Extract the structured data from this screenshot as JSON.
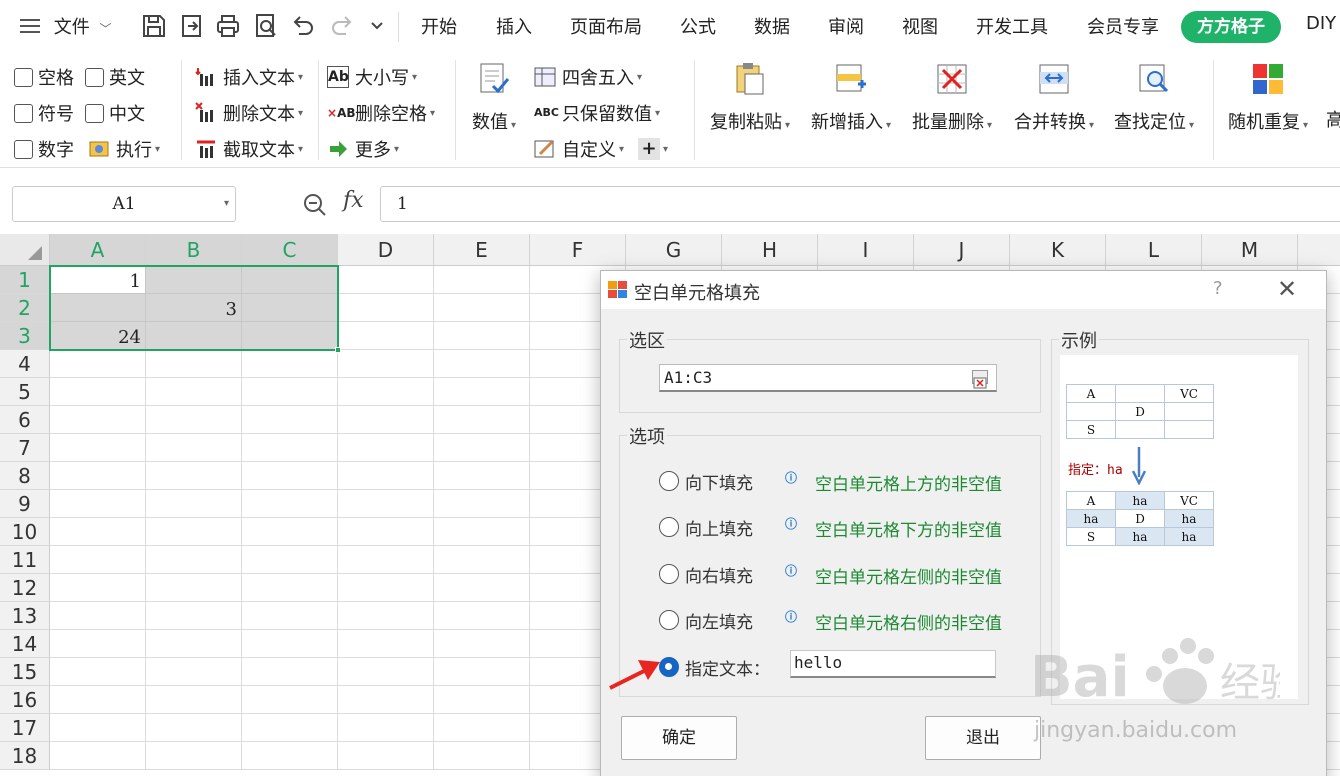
{
  "menu": {
    "file": "文件",
    "tabs": [
      "开始",
      "插入",
      "页面布局",
      "公式",
      "数据",
      "审阅",
      "视图",
      "开发工具",
      "会员专享"
    ],
    "active_tab": "方方格子",
    "diy": "DIY"
  },
  "ribbon": {
    "checkboxes": [
      "空格",
      "英文",
      "符号",
      "中文",
      "数字"
    ],
    "execute": "执行",
    "text_tools": [
      "插入文本",
      "删除文本",
      "截取文本"
    ],
    "case_tools": [
      "大小写",
      "删除空格",
      "更多"
    ],
    "numeric": "数值",
    "round_tools": [
      "四舍五入",
      "只保留数值",
      "自定义"
    ],
    "big_buttons": [
      "复制粘贴",
      "新增插入",
      "批量删除",
      "合并转换",
      "查找定位",
      "随机重复"
    ],
    "more_cut": "高"
  },
  "formula_bar": {
    "name_box": "A1",
    "fx": "fx",
    "value": "1"
  },
  "sheet": {
    "columns": [
      "A",
      "B",
      "C",
      "D",
      "E",
      "F",
      "G",
      "H",
      "I",
      "J",
      "K",
      "L",
      "M"
    ],
    "rows": [
      "1",
      "2",
      "3",
      "4",
      "5",
      "6",
      "7",
      "8",
      "9",
      "10",
      "11",
      "12",
      "13",
      "14",
      "15",
      "16",
      "17",
      "18"
    ],
    "cells": {
      "A1": "1",
      "B2": "3",
      "A3": "24"
    }
  },
  "dialog": {
    "title": "空白单元格填充",
    "help": "?",
    "close": "✕",
    "range_section": "选区",
    "range_value": "A1:C3",
    "options_section": "选项",
    "options": [
      {
        "label": "向下填充",
        "hint": "空白单元格上方的非空值"
      },
      {
        "label": "向上填充",
        "hint": "空白单元格下方的非空值"
      },
      {
        "label": "向右填充",
        "hint": "空白单元格左侧的非空值"
      },
      {
        "label": "向左填充",
        "hint": "空白单元格右侧的非空值"
      }
    ],
    "specify_label": "指定文本：",
    "specify_value": "hello",
    "example_section": "示例",
    "example_before": [
      [
        "A",
        "",
        "VC"
      ],
      [
        "",
        "D",
        ""
      ],
      [
        "S",
        "",
        ""
      ]
    ],
    "example_label": "指定：ha",
    "example_after": [
      [
        "A",
        "ha",
        "VC"
      ],
      [
        "ha",
        "D",
        "ha"
      ],
      [
        "S",
        "ha",
        "ha"
      ]
    ],
    "ok": "确定",
    "cancel": "退出"
  },
  "watermark": {
    "text": "jingyan.baidu.com",
    "logo_text": "Baidu 经验"
  },
  "colors": {
    "accent_green": "#1fb36a",
    "selection_green": "#1fa463",
    "hint_green": "#1d8a33",
    "radio_blue": "#1664c4",
    "arrow_red": "#e8251f"
  }
}
